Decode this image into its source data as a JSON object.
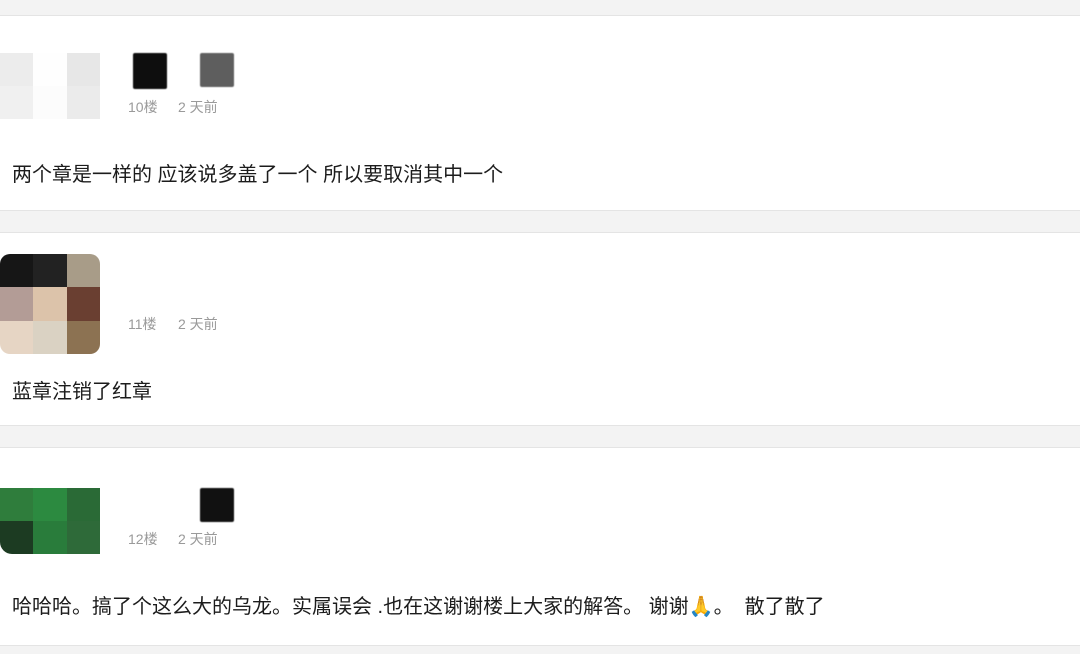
{
  "comments": [
    {
      "floor": "10楼",
      "time": "2 天前",
      "text": "两个章是一样的 应该说多盖了一个 所以要取消其中一个",
      "avatar_colors": [
        "#ececec",
        "#fefefe",
        "#e7e7e7",
        "#f0f0f0",
        "#fcfcfc",
        "#ebebeb"
      ],
      "username_mosaic_colors": [
        "#0e0e0e",
        "#5e5e5e"
      ]
    },
    {
      "floor": "11楼",
      "time": "2 天前",
      "text": "蓝章注销了红章",
      "avatar_colors": [
        "#161616",
        "#222222",
        "#a89c88",
        "#b39c96",
        "#dcc3aa",
        "#6a3f31",
        "#e6d5c4",
        "#dad2c3",
        "#8c7252"
      ]
    },
    {
      "floor": "12楼",
      "time": "2 天前",
      "text": "哈哈哈。搞了个这么大的乌龙。实属误会 .也在这谢谢楼上大家的解答。 谢谢🙏。  散了散了",
      "avatar_colors": [
        "#2f7d3c",
        "#2c8a40",
        "#2a6a36",
        "#1c3b22",
        "#297c3b",
        "#2e6a39"
      ],
      "username_mosaic_colors": [
        "#111111"
      ]
    }
  ]
}
